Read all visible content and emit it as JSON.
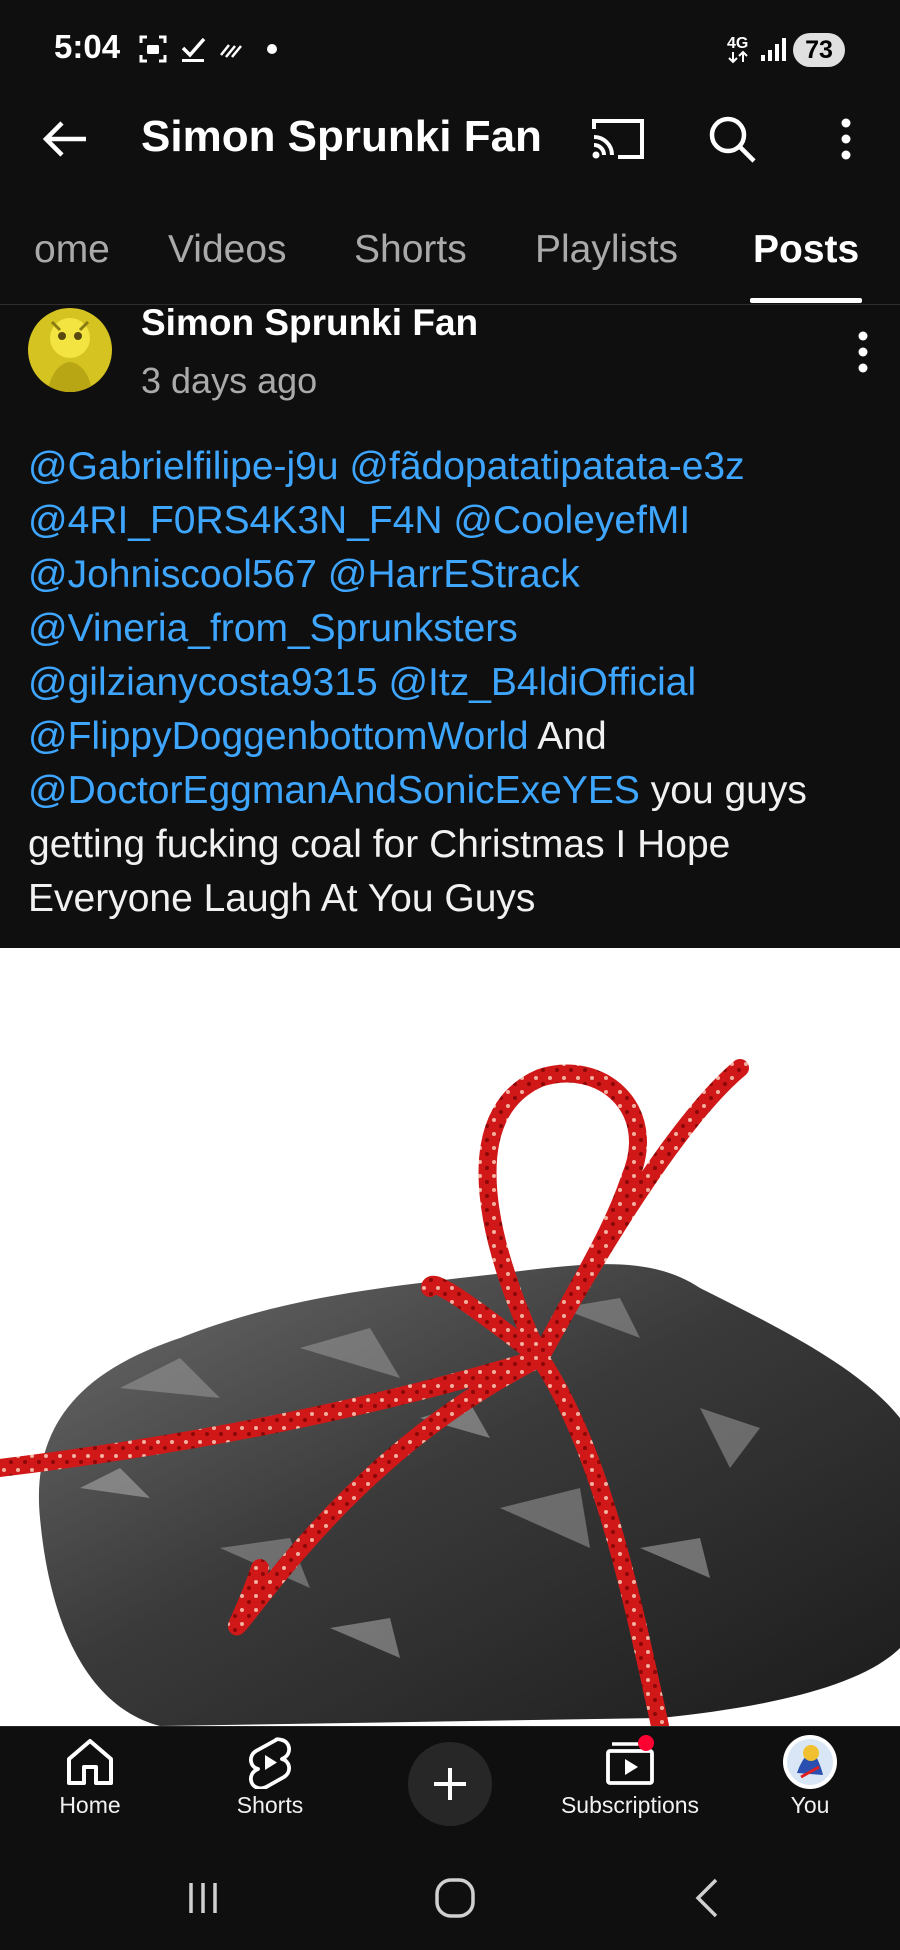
{
  "status_bar": {
    "time": "5:04",
    "network": "4G",
    "battery": "73"
  },
  "app_bar": {
    "title": "Simon Sprunki Fan"
  },
  "tabs": [
    {
      "label": "ome",
      "active": false
    },
    {
      "label": "Videos",
      "active": false
    },
    {
      "label": "Shorts",
      "active": false
    },
    {
      "label": "Playlists",
      "active": false
    },
    {
      "label": "Posts",
      "active": true
    }
  ],
  "post": {
    "author": "Simon Sprunki Fan",
    "time": "3 days ago",
    "lines": [
      [
        {
          "t": "@Gabrielfilipe-j9u @fãdopatatipatata-e3z",
          "m": true
        }
      ],
      [
        {
          "t": "@4RI_F0RS4K3N_F4N @CooleyefMI",
          "m": true
        }
      ],
      [
        {
          "t": "@Johniscool567 @HarrEStrack",
          "m": true
        }
      ],
      [
        {
          "t": "@Vineria_from_Sprunksters",
          "m": true
        }
      ],
      [
        {
          "t": "@gilzianycosta9315 @Itz_B4ldiOfficial",
          "m": true
        }
      ],
      [
        {
          "t": "@FlippyDoggenbottomWorld",
          "m": true
        },
        {
          "t": " And",
          "m": false
        }
      ],
      [
        {
          "t": "@DoctorEggmanAndSonicExeYES",
          "m": true
        },
        {
          "t": " you guys",
          "m": false
        }
      ],
      [
        {
          "t": "getting fucking coal for Christmas I Hope",
          "m": false
        }
      ],
      [
        {
          "t": "Everyone Laugh At You Guys",
          "m": false
        }
      ]
    ],
    "image_subject": "coal lump tied with red ribbon"
  },
  "bottom_nav": {
    "home": "Home",
    "shorts": "Shorts",
    "subscriptions": "Subscriptions",
    "you": "You"
  },
  "colors": {
    "background": "#0f0f0f",
    "mention": "#3ea6ff",
    "secondary_text": "#aaaaaa",
    "notification_dot": "#ff0033"
  }
}
